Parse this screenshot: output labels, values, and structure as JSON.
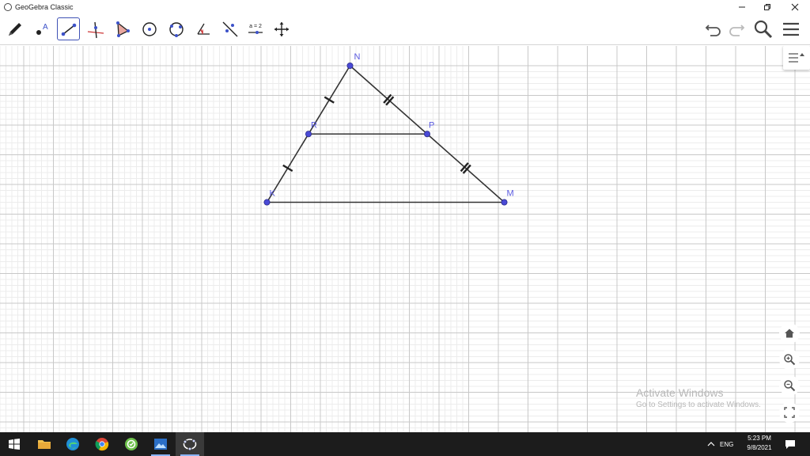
{
  "window": {
    "title": "GeoGebra Classic",
    "controls": [
      "minimize",
      "restore",
      "close"
    ]
  },
  "toolbar": {
    "tools": [
      {
        "name": "pen-tool",
        "icon": "pen-icon"
      },
      {
        "name": "point-tool",
        "icon": "point-icon"
      },
      {
        "name": "segment-tool",
        "icon": "segment-icon",
        "active": true
      },
      {
        "name": "perpendicular-line-tool",
        "icon": "perpendicular-icon"
      },
      {
        "name": "polygon-tool",
        "icon": "polygon-icon"
      },
      {
        "name": "circle-center-point-tool",
        "icon": "circle-icon"
      },
      {
        "name": "circle-three-points-tool",
        "icon": "circle-three-points-icon"
      },
      {
        "name": "angle-tool",
        "icon": "angle-icon"
      },
      {
        "name": "reflect-tool",
        "icon": "reflect-icon"
      },
      {
        "name": "slider-tool",
        "icon": "slider-icon",
        "label": "a = 2"
      },
      {
        "name": "move-graphics-tool",
        "icon": "move-icon"
      }
    ],
    "right": [
      "undo-icon",
      "redo-icon",
      "search-icon",
      "menu-icon"
    ]
  },
  "construction": {
    "points": [
      {
        "label": "N",
        "x": 4,
        "y": 8
      },
      {
        "label": "R",
        "x": 2.6,
        "y": 5.7
      },
      {
        "label": "P",
        "x": 6.6,
        "y": 5.7
      },
      {
        "label": "K",
        "x": 1.2,
        "y": 3.4
      },
      {
        "label": "M",
        "x": 9.2,
        "y": 3.4
      }
    ],
    "segments": [
      [
        "K",
        "N"
      ],
      [
        "N",
        "M"
      ],
      [
        "K",
        "M"
      ],
      [
        "R",
        "P"
      ]
    ],
    "tick_marks": [
      {
        "segment": [
          "R",
          "N"
        ],
        "count": 1
      },
      {
        "segment": [
          "K",
          "R"
        ],
        "count": 1
      },
      {
        "segment": [
          "N",
          "P"
        ],
        "count": 2
      },
      {
        "segment": [
          "P",
          "M"
        ],
        "count": 2
      }
    ],
    "colors": {
      "point": "#4a4ad6",
      "point_label": "#5a5ae0",
      "segment": "#333333",
      "grid_major": "#c8c8c8",
      "grid_minor": "#ececec"
    }
  },
  "side_buttons": [
    "home-icon",
    "zoom-in-icon",
    "zoom-out-icon",
    "fullscreen-icon"
  ],
  "watermark": {
    "line1": "Activate Windows",
    "line2": "Go to Settings to activate Windows."
  },
  "taskbar": {
    "apps": [
      "windows-start-icon",
      "file-explorer-icon",
      "edge-icon",
      "chrome-icon",
      "app-icon",
      "photos-icon",
      "geogebra-icon"
    ],
    "language": "ENG",
    "time": "5:23 PM",
    "date": "9/8/2021"
  }
}
